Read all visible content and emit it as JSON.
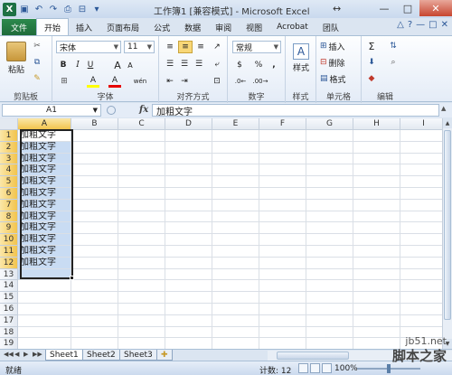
{
  "window": {
    "title": "工作簿1  [兼容模式] - Microsoft Excel",
    "app_letter": "X",
    "minimize": "—",
    "restore": "□",
    "close": "✕",
    "resize_glyph": "↔"
  },
  "tabs": {
    "file": "文件",
    "items": [
      "开始",
      "插入",
      "页面布局",
      "公式",
      "数据",
      "审阅",
      "视图",
      "Acrobat",
      "团队"
    ],
    "active": "开始",
    "right_icons": [
      "△",
      "?",
      "—",
      "□",
      "✕"
    ]
  },
  "ribbon": {
    "clipboard": {
      "label": "剪贴板",
      "paste": "粘贴"
    },
    "font": {
      "label": "字体",
      "name": "宋体",
      "size": "11",
      "bold": "B",
      "italic": "I",
      "underline": "U",
      "grow": "A",
      "shrink": "A",
      "fill_color": "A",
      "font_color": "A",
      "wen": "wén"
    },
    "alignment": {
      "label": "对齐方式"
    },
    "number": {
      "label": "数字",
      "format": "常规",
      "percent": "%",
      "comma": ",",
      "currency": "$"
    },
    "styles": {
      "label": "样式",
      "button": "样式"
    },
    "cells": {
      "label": "单元格",
      "insert": "插入",
      "delete": "删除",
      "format": "格式"
    },
    "editing": {
      "label": "编辑",
      "sum": "Σ"
    }
  },
  "formula_bar": {
    "name_box": "A1",
    "fx": "fx",
    "value": "加粗文字"
  },
  "grid": {
    "columns": [
      "A",
      "B",
      "C",
      "D",
      "E",
      "F",
      "G",
      "H",
      "I"
    ],
    "rows": [
      "1",
      "2",
      "3",
      "4",
      "5",
      "6",
      "7",
      "8",
      "9",
      "10",
      "11",
      "12",
      "13",
      "14",
      "15",
      "16",
      "17",
      "18",
      "19"
    ],
    "cells_A": [
      "加粗文字",
      "加粗文字",
      "加粗文字",
      "加粗文字",
      "加粗文字",
      "加粗文字",
      "加粗文字",
      "加粗文字",
      "加粗文字",
      "加粗文字",
      "加粗文字",
      "加粗文字"
    ]
  },
  "sheets": {
    "tabs": [
      "Sheet1",
      "Sheet2",
      "Sheet3"
    ],
    "active": "Sheet1",
    "nav": [
      "◀◀",
      "◀",
      "▶",
      "▶▶"
    ]
  },
  "status": {
    "ready": "就绪",
    "count": "计数: 12",
    "zoom": "100%"
  },
  "watermark": {
    "site": "jb51.net",
    "name": "脚本之家"
  },
  "colors": {
    "file_tab": "#1e7145",
    "selection": "#c9dcf3",
    "header_selected": "#f2c44d"
  }
}
